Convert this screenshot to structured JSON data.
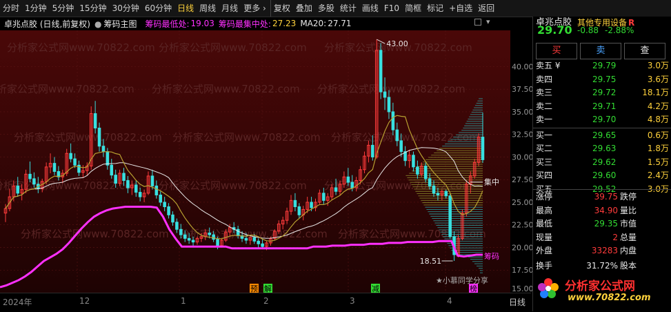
{
  "toolbar": {
    "periods": [
      "分时",
      "1分钟",
      "5分钟",
      "15分钟",
      "30分钟",
      "60分钟",
      "日线",
      "周线",
      "月线",
      "更多 ›"
    ],
    "active": "日线",
    "tools": [
      "复权",
      "叠加",
      "多股",
      "统计",
      "画线",
      "F10",
      "简框",
      "标记",
      "+自选",
      "返回"
    ]
  },
  "info": {
    "stock": "卓兆点胶 (日线,前复权)",
    "indicator": "筹码主图",
    "low_label": "筹码最低处:",
    "low_value": "19.03",
    "conc_label": "筹码最集中处:",
    "conc_value": "27.23",
    "ma_label": "MA20:",
    "ma_value": "27.71"
  },
  "axis": {
    "ticks": [
      "40.00",
      "37.50",
      "35.00",
      "32.50",
      "30.00",
      "27.50",
      "25.00",
      "22.50",
      "20.00",
      "17.50",
      "15.00"
    ]
  },
  "annotations": {
    "high": "43.00",
    "low": "18.51",
    "zhong": "集中",
    "chouma": "筹码",
    "signature": "★小慕同学分享"
  },
  "signals": [
    "预",
    "解",
    "减",
    "榜"
  ],
  "dates": {
    "year": "2024年",
    "m12": "12",
    "m1": "1",
    "m2": "2",
    "m3": "3",
    "m4": "4",
    "period": "日线"
  },
  "watermark": "分析家公式网www.70822.com",
  "side": {
    "name": "卓兆点胶",
    "device": "其他专用设备",
    "badge": "R",
    "price": "29.70",
    "change": "-0.88",
    "pct": "-2.88%",
    "buttons": [
      "买",
      "卖",
      "查"
    ],
    "asks": [
      {
        "label": "卖五 ¥",
        "price": "29.79",
        "vol": "3.0万"
      },
      {
        "label": "卖四",
        "price": "29.75",
        "vol": "3.6万"
      },
      {
        "label": "卖三",
        "price": "29.72",
        "vol": "18.1万"
      },
      {
        "label": "卖二",
        "price": "29.71",
        "vol": "4.2万"
      },
      {
        "label": "卖一",
        "price": "29.70",
        "vol": "4.8万"
      }
    ],
    "bids": [
      {
        "label": "买一",
        "price": "29.65",
        "vol": "0.6万"
      },
      {
        "label": "买二",
        "price": "29.63",
        "vol": "1.8万"
      },
      {
        "label": "买三",
        "price": "29.62",
        "vol": "1.5万"
      },
      {
        "label": "买四",
        "price": "29.60",
        "vol": "2.4万"
      },
      {
        "label": "买五",
        "price": "29.52",
        "vol": "3.0万"
      }
    ],
    "stats": [
      {
        "l1": "涨停",
        "v1": "39.75",
        "l2": "跌停"
      },
      {
        "l1": "最高",
        "v1": "34.90",
        "l2": "量比"
      },
      {
        "l1": "最低",
        "v1": "29.35",
        "l2": "市值"
      },
      {
        "l1": "现量",
        "v1": "2",
        "l2": "总量"
      },
      {
        "l1": "外盘",
        "v1": "33283",
        "l2": "内盘"
      },
      {
        "l1": "换手",
        "v1": "31.72%",
        "l2": "股本"
      }
    ],
    "logo": "分析家公式网",
    "logo_url": "www.70822.com"
  },
  "colors": {
    "up": "#ff3b3b",
    "down": "#38e0e0",
    "ma": "#e8e8e8",
    "ma2": "#b8a030",
    "chip": "#ff30ff",
    "bg_chart": "#3a0606"
  },
  "chart_data": {
    "type": "candlestick",
    "ylim": [
      15,
      44
    ],
    "high_marker": 43.0,
    "low_marker": 18.51,
    "lowest_chip": 19.03,
    "most_concentrated_chip": 27.23,
    "ma20": 27.71,
    "candles": [
      {
        "o": 23.8,
        "h": 24.8,
        "l": 22.8,
        "c": 24.3
      },
      {
        "o": 24.3,
        "h": 26.5,
        "l": 24.0,
        "c": 25.6
      },
      {
        "o": 25.6,
        "h": 27.4,
        "l": 25.1,
        "c": 26.8
      },
      {
        "o": 26.8,
        "h": 27.8,
        "l": 25.6,
        "c": 26.0
      },
      {
        "o": 26.0,
        "h": 27.0,
        "l": 25.2,
        "c": 26.4
      },
      {
        "o": 26.4,
        "h": 28.6,
        "l": 26.0,
        "c": 28.1
      },
      {
        "o": 28.1,
        "h": 29.5,
        "l": 27.2,
        "c": 27.6
      },
      {
        "o": 27.6,
        "h": 28.3,
        "l": 26.6,
        "c": 27.0
      },
      {
        "o": 27.0,
        "h": 27.8,
        "l": 26.0,
        "c": 26.5
      },
      {
        "o": 26.5,
        "h": 27.6,
        "l": 26.1,
        "c": 27.3
      },
      {
        "o": 27.3,
        "h": 29.4,
        "l": 27.0,
        "c": 28.9
      },
      {
        "o": 28.9,
        "h": 30.4,
        "l": 28.2,
        "c": 29.3
      },
      {
        "o": 29.3,
        "h": 30.0,
        "l": 28.0,
        "c": 28.4
      },
      {
        "o": 28.4,
        "h": 29.0,
        "l": 27.4,
        "c": 27.8
      },
      {
        "o": 27.8,
        "h": 28.6,
        "l": 27.1,
        "c": 28.2
      },
      {
        "o": 28.2,
        "h": 30.9,
        "l": 27.9,
        "c": 30.4
      },
      {
        "o": 30.4,
        "h": 31.5,
        "l": 29.4,
        "c": 29.8
      },
      {
        "o": 29.8,
        "h": 30.4,
        "l": 28.8,
        "c": 29.1
      },
      {
        "o": 29.1,
        "h": 29.6,
        "l": 27.9,
        "c": 28.3
      },
      {
        "o": 28.3,
        "h": 29.1,
        "l": 27.7,
        "c": 28.5
      },
      {
        "o": 28.5,
        "h": 29.4,
        "l": 28.0,
        "c": 29.0
      },
      {
        "o": 29.0,
        "h": 35.6,
        "l": 28.6,
        "c": 34.8
      },
      {
        "o": 34.8,
        "h": 36.2,
        "l": 32.6,
        "c": 33.2
      },
      {
        "o": 33.2,
        "h": 33.8,
        "l": 30.6,
        "c": 31.2
      },
      {
        "o": 31.2,
        "h": 32.0,
        "l": 30.0,
        "c": 30.6
      },
      {
        "o": 30.6,
        "h": 31.0,
        "l": 28.6,
        "c": 29.1
      },
      {
        "o": 29.1,
        "h": 29.8,
        "l": 27.6,
        "c": 28.0
      },
      {
        "o": 28.0,
        "h": 28.6,
        "l": 26.6,
        "c": 27.1
      },
      {
        "o": 27.1,
        "h": 28.6,
        "l": 26.8,
        "c": 28.2
      },
      {
        "o": 28.2,
        "h": 28.8,
        "l": 26.8,
        "c": 27.4
      },
      {
        "o": 27.4,
        "h": 27.9,
        "l": 26.0,
        "c": 26.6
      },
      {
        "o": 26.6,
        "h": 27.4,
        "l": 25.8,
        "c": 26.9
      },
      {
        "o": 26.9,
        "h": 27.4,
        "l": 25.6,
        "c": 26.1
      },
      {
        "o": 26.1,
        "h": 26.6,
        "l": 25.1,
        "c": 25.6
      },
      {
        "o": 25.6,
        "h": 26.4,
        "l": 25.0,
        "c": 26.0
      },
      {
        "o": 26.0,
        "h": 28.4,
        "l": 25.8,
        "c": 27.9
      },
      {
        "o": 27.9,
        "h": 28.6,
        "l": 26.4,
        "c": 26.8
      },
      {
        "o": 26.8,
        "h": 27.4,
        "l": 25.4,
        "c": 25.8
      },
      {
        "o": 25.8,
        "h": 26.2,
        "l": 24.6,
        "c": 25.0
      },
      {
        "o": 25.0,
        "h": 25.6,
        "l": 24.0,
        "c": 24.5
      },
      {
        "o": 24.5,
        "h": 24.9,
        "l": 23.2,
        "c": 23.6
      },
      {
        "o": 23.6,
        "h": 24.0,
        "l": 22.4,
        "c": 22.8
      },
      {
        "o": 22.8,
        "h": 23.2,
        "l": 21.6,
        "c": 22.0
      },
      {
        "o": 22.0,
        "h": 22.6,
        "l": 21.0,
        "c": 21.4
      },
      {
        "o": 21.4,
        "h": 21.9,
        "l": 20.6,
        "c": 21.0
      },
      {
        "o": 21.0,
        "h": 21.6,
        "l": 20.4,
        "c": 20.8
      },
      {
        "o": 20.8,
        "h": 21.2,
        "l": 20.2,
        "c": 20.6
      },
      {
        "o": 20.6,
        "h": 21.2,
        "l": 20.3,
        "c": 21.0
      },
      {
        "o": 21.0,
        "h": 21.6,
        "l": 20.6,
        "c": 21.2
      },
      {
        "o": 21.2,
        "h": 22.0,
        "l": 20.8,
        "c": 21.6
      },
      {
        "o": 21.6,
        "h": 22.2,
        "l": 21.0,
        "c": 21.4
      },
      {
        "o": 21.4,
        "h": 21.8,
        "l": 20.6,
        "c": 20.9
      },
      {
        "o": 20.9,
        "h": 21.2,
        "l": 19.8,
        "c": 20.2
      },
      {
        "o": 20.2,
        "h": 21.0,
        "l": 20.0,
        "c": 20.8
      },
      {
        "o": 20.8,
        "h": 22.0,
        "l": 20.6,
        "c": 21.7
      },
      {
        "o": 21.7,
        "h": 22.6,
        "l": 21.2,
        "c": 22.2
      },
      {
        "o": 22.2,
        "h": 22.8,
        "l": 21.6,
        "c": 22.0
      },
      {
        "o": 22.0,
        "h": 22.4,
        "l": 21.0,
        "c": 21.3
      },
      {
        "o": 21.3,
        "h": 21.8,
        "l": 20.6,
        "c": 21.0
      },
      {
        "o": 21.0,
        "h": 21.6,
        "l": 20.4,
        "c": 20.8
      },
      {
        "o": 20.8,
        "h": 21.4,
        "l": 20.3,
        "c": 21.1
      },
      {
        "o": 21.1,
        "h": 21.5,
        "l": 20.4,
        "c": 20.7
      },
      {
        "o": 20.7,
        "h": 21.0,
        "l": 20.0,
        "c": 20.4
      },
      {
        "o": 20.4,
        "h": 20.9,
        "l": 19.8,
        "c": 20.1
      },
      {
        "o": 20.1,
        "h": 20.7,
        "l": 19.7,
        "c": 20.5
      },
      {
        "o": 20.5,
        "h": 21.2,
        "l": 20.2,
        "c": 21.0
      },
      {
        "o": 21.0,
        "h": 22.0,
        "l": 20.8,
        "c": 21.8
      },
      {
        "o": 21.8,
        "h": 23.0,
        "l": 21.5,
        "c": 22.6
      },
      {
        "o": 22.6,
        "h": 23.4,
        "l": 22.0,
        "c": 23.0
      },
      {
        "o": 23.0,
        "h": 24.4,
        "l": 22.6,
        "c": 24.0
      },
      {
        "o": 24.0,
        "h": 25.8,
        "l": 23.6,
        "c": 25.2
      },
      {
        "o": 25.2,
        "h": 26.0,
        "l": 24.0,
        "c": 24.5
      },
      {
        "o": 24.5,
        "h": 24.9,
        "l": 23.2,
        "c": 23.6
      },
      {
        "o": 23.6,
        "h": 24.6,
        "l": 23.0,
        "c": 24.2
      },
      {
        "o": 24.2,
        "h": 25.6,
        "l": 23.8,
        "c": 25.0
      },
      {
        "o": 25.0,
        "h": 25.6,
        "l": 24.0,
        "c": 24.4
      },
      {
        "o": 24.4,
        "h": 25.4,
        "l": 24.0,
        "c": 25.0
      },
      {
        "o": 25.0,
        "h": 26.4,
        "l": 24.8,
        "c": 26.0
      },
      {
        "o": 26.0,
        "h": 26.6,
        "l": 24.8,
        "c": 25.2
      },
      {
        "o": 25.2,
        "h": 26.0,
        "l": 24.6,
        "c": 25.6
      },
      {
        "o": 25.6,
        "h": 27.0,
        "l": 25.2,
        "c": 26.6
      },
      {
        "o": 26.6,
        "h": 27.6,
        "l": 25.8,
        "c": 26.2
      },
      {
        "o": 26.2,
        "h": 27.4,
        "l": 25.8,
        "c": 27.0
      },
      {
        "o": 27.0,
        "h": 28.4,
        "l": 26.6,
        "c": 27.8
      },
      {
        "o": 27.8,
        "h": 28.8,
        "l": 26.8,
        "c": 27.2
      },
      {
        "o": 27.2,
        "h": 28.0,
        "l": 26.2,
        "c": 26.6
      },
      {
        "o": 26.6,
        "h": 27.8,
        "l": 26.2,
        "c": 27.4
      },
      {
        "o": 27.4,
        "h": 29.0,
        "l": 27.0,
        "c": 28.6
      },
      {
        "o": 28.6,
        "h": 30.6,
        "l": 28.2,
        "c": 30.1
      },
      {
        "o": 30.1,
        "h": 31.8,
        "l": 29.4,
        "c": 31.3
      },
      {
        "o": 31.3,
        "h": 32.4,
        "l": 29.6,
        "c": 30.0
      },
      {
        "o": 30.0,
        "h": 43.0,
        "l": 29.8,
        "c": 41.8
      },
      {
        "o": 41.8,
        "h": 42.6,
        "l": 36.4,
        "c": 37.2
      },
      {
        "o": 37.2,
        "h": 38.8,
        "l": 35.2,
        "c": 36.6
      },
      {
        "o": 36.6,
        "h": 37.4,
        "l": 34.2,
        "c": 35.0
      },
      {
        "o": 35.0,
        "h": 36.0,
        "l": 32.4,
        "c": 33.0
      },
      {
        "o": 33.0,
        "h": 33.8,
        "l": 31.2,
        "c": 31.8
      },
      {
        "o": 31.8,
        "h": 32.6,
        "l": 30.0,
        "c": 30.6
      },
      {
        "o": 30.6,
        "h": 31.2,
        "l": 29.0,
        "c": 29.6
      },
      {
        "o": 29.6,
        "h": 30.8,
        "l": 28.8,
        "c": 30.2
      },
      {
        "o": 30.2,
        "h": 30.6,
        "l": 28.4,
        "c": 28.9
      },
      {
        "o": 28.9,
        "h": 29.6,
        "l": 27.6,
        "c": 28.1
      },
      {
        "o": 28.1,
        "h": 29.4,
        "l": 27.8,
        "c": 29.0
      },
      {
        "o": 29.0,
        "h": 29.4,
        "l": 27.2,
        "c": 27.6
      },
      {
        "o": 27.6,
        "h": 28.2,
        "l": 26.4,
        "c": 26.8
      },
      {
        "o": 26.8,
        "h": 27.4,
        "l": 25.6,
        "c": 26.0
      },
      {
        "o": 26.0,
        "h": 26.6,
        "l": 25.2,
        "c": 25.8
      },
      {
        "o": 25.8,
        "h": 26.4,
        "l": 25.2,
        "c": 26.2
      },
      {
        "o": 26.2,
        "h": 26.4,
        "l": 25.4,
        "c": 25.7
      },
      {
        "o": 25.7,
        "h": 25.9,
        "l": 21.0,
        "c": 21.2
      },
      {
        "o": 21.2,
        "h": 21.8,
        "l": 18.51,
        "c": 19.2
      },
      {
        "o": 19.2,
        "h": 21.4,
        "l": 18.9,
        "c": 21.0
      },
      {
        "o": 21.0,
        "h": 24.2,
        "l": 20.8,
        "c": 23.8
      },
      {
        "o": 23.8,
        "h": 27.4,
        "l": 23.4,
        "c": 27.0
      },
      {
        "o": 27.0,
        "h": 28.4,
        "l": 26.0,
        "c": 27.9
      },
      {
        "o": 27.9,
        "h": 29.8,
        "l": 27.6,
        "c": 29.4
      },
      {
        "o": 29.4,
        "h": 32.6,
        "l": 29.0,
        "c": 32.2
      },
      {
        "o": 32.2,
        "h": 34.9,
        "l": 29.35,
        "c": 29.7
      }
    ],
    "chip_line": [
      15.6,
      15.8,
      16.1,
      16.4,
      16.8,
      17.3,
      17.9,
      18.5,
      18.9,
      19.3,
      19.8,
      20.5,
      21.3,
      22.1,
      22.8,
      23.4,
      23.8,
      24.1,
      24.3,
      24.4,
      24.5,
      24.5,
      24.5,
      24.5,
      24.5,
      24.4,
      23.4,
      22.0,
      21.0,
      20.1,
      20.1,
      20.1,
      20.1,
      20.1,
      20.1,
      20.1,
      20.1,
      19.9,
      19.9,
      19.9,
      19.9,
      19.9,
      19.9,
      19.9,
      19.9,
      19.9,
      19.9,
      19.9,
      19.9,
      19.9,
      20.1,
      20.1,
      20.1,
      20.2,
      20.2,
      20.2,
      20.3,
      20.3,
      20.3,
      20.4,
      20.4,
      20.4,
      20.5,
      20.5,
      20.5,
      20.6,
      20.6,
      20.6,
      20.6,
      20.6,
      20.7,
      20.7,
      20.7,
      19.1,
      19.0,
      19.1,
      19.2,
      19.2
    ]
  }
}
